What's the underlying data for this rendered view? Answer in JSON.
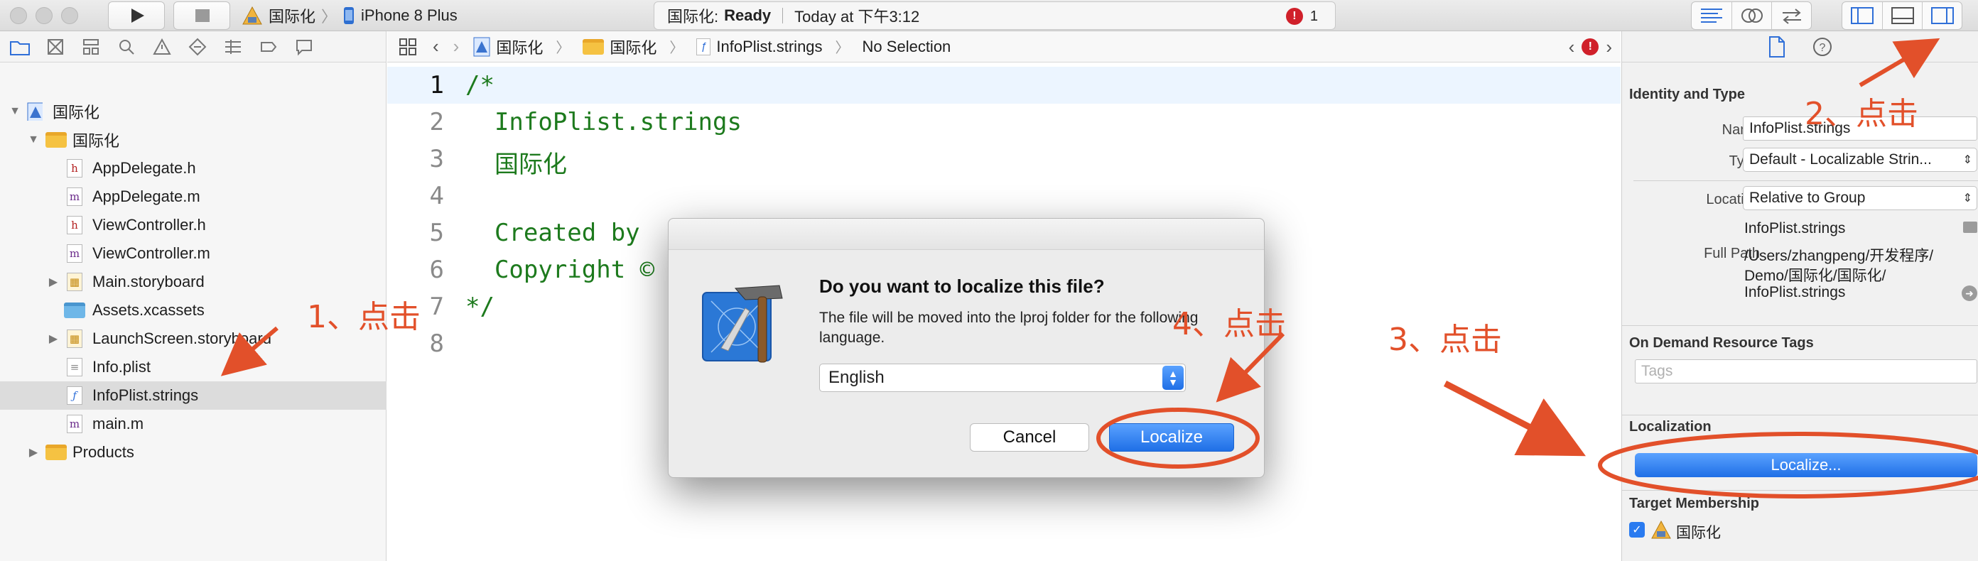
{
  "toolbar": {
    "scheme_target": "国际化",
    "scheme_device": "iPhone 8 Plus",
    "status_app": "国际化:",
    "status_state": "Ready",
    "status_time": "Today at 下午3:12",
    "error_count": "1"
  },
  "navigator": {
    "items": [
      {
        "label": "国际化"
      },
      {
        "label": "国际化"
      },
      {
        "label": "AppDelegate.h"
      },
      {
        "label": "AppDelegate.m"
      },
      {
        "label": "ViewController.h"
      },
      {
        "label": "ViewController.m"
      },
      {
        "label": "Main.storyboard"
      },
      {
        "label": "Assets.xcassets"
      },
      {
        "label": "LaunchScreen.storyboard"
      },
      {
        "label": "Info.plist"
      },
      {
        "label": "InfoPlist.strings"
      },
      {
        "label": "main.m"
      },
      {
        "label": "Products"
      }
    ]
  },
  "editor": {
    "breadcrumb": [
      "国际化",
      "国际化",
      "InfoPlist.strings",
      "No Selection"
    ],
    "lines": [
      {
        "num": "1",
        "text": "/*"
      },
      {
        "num": "2",
        "text": "  InfoPlist.strings"
      },
      {
        "num": "3",
        "text": "  国际化"
      },
      {
        "num": "4",
        "text": ""
      },
      {
        "num": "5",
        "text": "  Created by"
      },
      {
        "num": "6",
        "text": "  Copyright ©"
      },
      {
        "num": "7",
        "text": "*/"
      },
      {
        "num": "8",
        "text": ""
      }
    ]
  },
  "inspector": {
    "identity_title": "Identity and Type",
    "name_label": "Name",
    "name_value": "InfoPlist.strings",
    "type_label": "Type",
    "type_value": "Default - Localizable Strin...",
    "location_label": "Location",
    "location_value": "Relative to Group",
    "location_file": "InfoPlist.strings",
    "fullpath_label": "Full Path",
    "fullpath_line1": "/Users/zhangpeng/开发程序/",
    "fullpath_line2": "Demo/国际化/国际化/",
    "fullpath_line3": "InfoPlist.strings",
    "odr_title": "On Demand Resource Tags",
    "tags_placeholder": "Tags",
    "localization_title": "Localization",
    "localize_button": "Localize...",
    "target_title": "Target Membership",
    "target_name": "国际化"
  },
  "dialog": {
    "title": "Do you want to localize this file?",
    "message": "The file will be moved into the lproj folder for the following language.",
    "language": "English",
    "cancel": "Cancel",
    "confirm": "Localize"
  },
  "annotations": {
    "step1": "1、点击",
    "step2": "2、点击",
    "step3": "3、点击",
    "step4": "4、点击",
    "color": "#e2502a"
  }
}
